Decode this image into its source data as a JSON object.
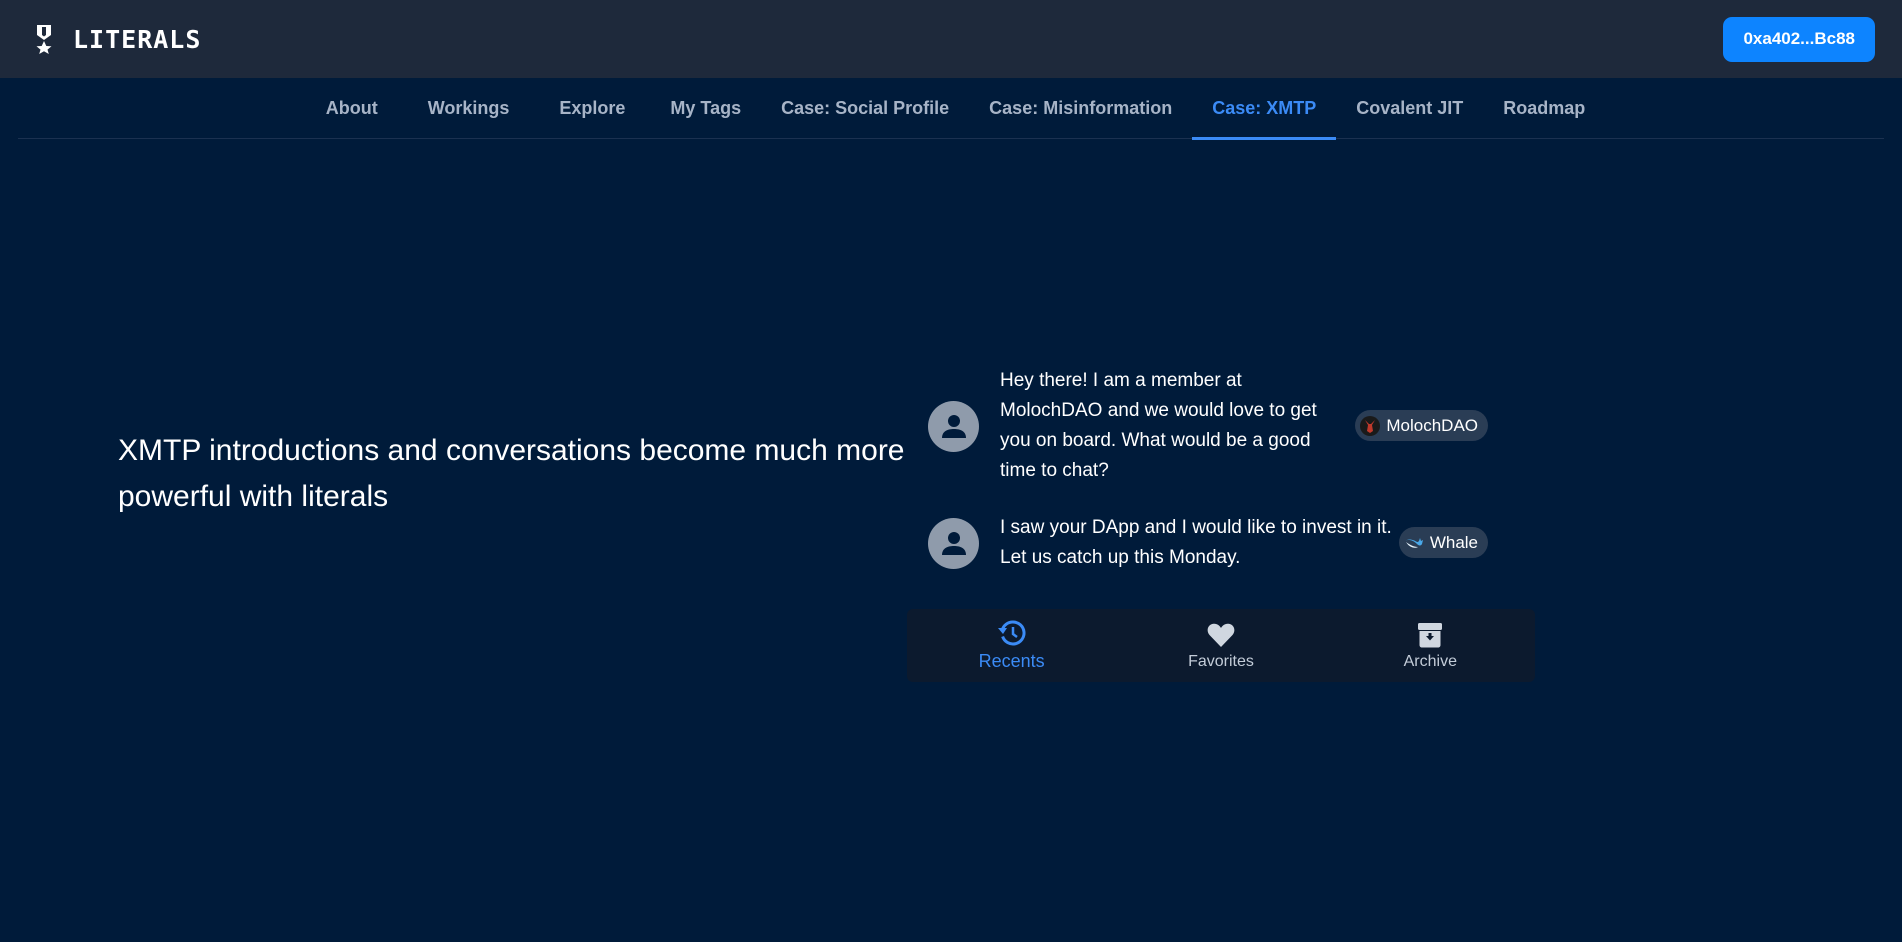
{
  "header": {
    "brand_icon": "medal-icon",
    "title": "LITERALS",
    "wallet_label": "0xa402...Bc88",
    "wallet_color": "#0d84ff"
  },
  "nav": {
    "tabs": [
      {
        "label": "About",
        "active": false
      },
      {
        "label": "Workings",
        "active": false
      },
      {
        "label": "Explore",
        "active": false
      },
      {
        "label": "My Tags",
        "active": false
      },
      {
        "label": "Case: Social Profile",
        "active": false
      },
      {
        "label": "Case: Misinformation",
        "active": false
      },
      {
        "label": "Case: XMTP",
        "active": true
      },
      {
        "label": "Covalent JIT",
        "active": false
      },
      {
        "label": "Roadmap",
        "active": false
      }
    ],
    "active_color": "#3b8bf6"
  },
  "main": {
    "headline": "XMTP introductions and conversations become much more powerful with literals"
  },
  "messages": [
    {
      "avatar_icon": "user-icon",
      "text": "Hey there! I am a member at MolochDAO and we would love to get you on board. What would be a good time to chat?",
      "tag": "MolochDAO",
      "tag_icon": "moloch-icon"
    },
    {
      "avatar_icon": "user-icon",
      "text": "I saw your DApp and I would like to invest in it. Let us catch up this Monday.",
      "tag": "Whale",
      "tag_icon": "whale-icon"
    }
  ],
  "bottom_nav": {
    "items": [
      {
        "label": "Recents",
        "icon": "history-icon",
        "active": true
      },
      {
        "label": "Favorites",
        "icon": "heart-icon",
        "active": false
      },
      {
        "label": "Archive",
        "icon": "archive-icon",
        "active": false
      }
    ]
  }
}
